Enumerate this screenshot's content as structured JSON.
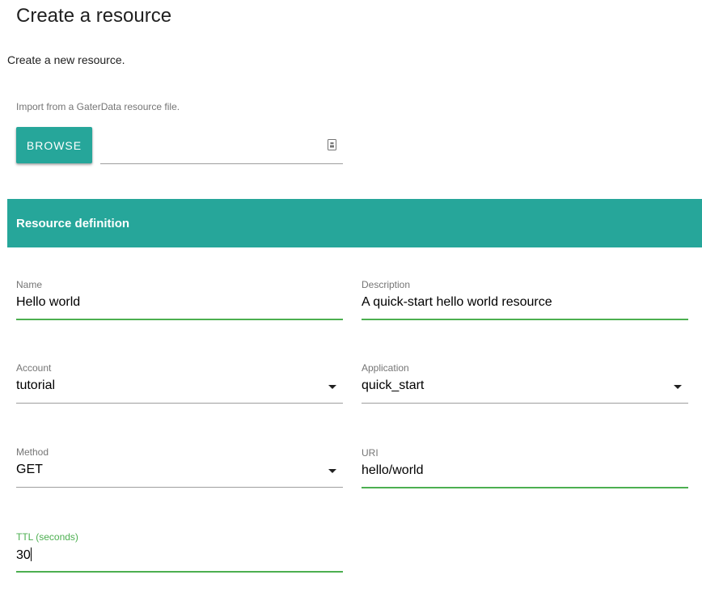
{
  "page": {
    "title": "Create a resource",
    "subtitle": "Create a new resource."
  },
  "import": {
    "label": "Import from a GaterData resource file.",
    "browse_label": "BROWSE",
    "file_path_value": "",
    "file_icon": "file-upload-icon"
  },
  "section": {
    "title": "Resource definition"
  },
  "form": {
    "name": {
      "label": "Name",
      "value": "Hello world"
    },
    "description": {
      "label": "Description",
      "value": "A quick-start hello world resource"
    },
    "account": {
      "label": "Account",
      "value": "tutorial",
      "icon": "caret-down-icon"
    },
    "application": {
      "label": "Application",
      "value": "quick_start",
      "icon": "caret-down-icon"
    },
    "method": {
      "label": "Method",
      "value": "GET",
      "icon": "caret-down-icon"
    },
    "uri": {
      "label": "URI",
      "value": "hello/world"
    },
    "ttl": {
      "label": "TTL (seconds)",
      "value": "30"
    }
  },
  "colors": {
    "accent": "#26a69a",
    "valid": "#4caf50",
    "label": "#757575",
    "line": "#9e9e9e"
  }
}
